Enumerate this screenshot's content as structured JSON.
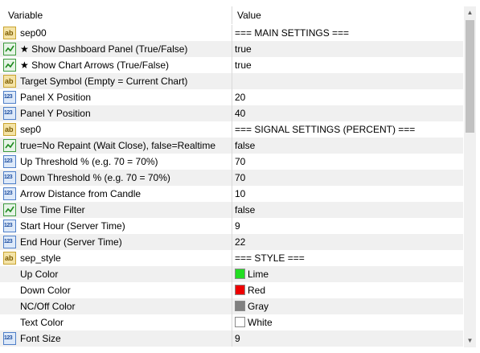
{
  "header": {
    "variable": "Variable",
    "value": "Value"
  },
  "rows": [
    {
      "type": "ab",
      "name": "sep00",
      "value": "=== MAIN SETTINGS ==="
    },
    {
      "type": "bool",
      "name": "★ Show Dashboard Panel (True/False)",
      "value": "true"
    },
    {
      "type": "bool",
      "name": "★ Show Chart Arrows (True/False)",
      "value": "true"
    },
    {
      "type": "ab",
      "name": "Target Symbol (Empty = Current Chart)",
      "value": ""
    },
    {
      "type": "num",
      "name": "Panel X Position",
      "value": "20"
    },
    {
      "type": "num",
      "name": "Panel Y Position",
      "value": "40"
    },
    {
      "type": "ab",
      "name": "sep0",
      "value": "=== SIGNAL SETTINGS (PERCENT) ==="
    },
    {
      "type": "bool",
      "name": "true=No Repaint (Wait Close), false=Realtime",
      "value": "false"
    },
    {
      "type": "num",
      "name": "Up Threshold % (e.g. 70 = 70%)",
      "value": "70"
    },
    {
      "type": "num",
      "name": "Down Threshold % (e.g. 70 = 70%)",
      "value": "70"
    },
    {
      "type": "num",
      "name": "Arrow Distance from Candle",
      "value": "10"
    },
    {
      "type": "bool",
      "name": "Use Time Filter",
      "value": "false"
    },
    {
      "type": "num",
      "name": "Start Hour (Server Time)",
      "value": "9"
    },
    {
      "type": "num",
      "name": "End Hour (Server Time)",
      "value": "22"
    },
    {
      "type": "ab",
      "name": "sep_style",
      "value": "=== STYLE ==="
    },
    {
      "type": "color",
      "name": "Up Color",
      "value": "Lime",
      "swatch": "#22dd22"
    },
    {
      "type": "color",
      "name": "Down Color",
      "value": "Red",
      "swatch": "#ee0000"
    },
    {
      "type": "color",
      "name": "NC/Off Color",
      "value": "Gray",
      "swatch": "#808080"
    },
    {
      "type": "color",
      "name": "Text Color",
      "value": "White",
      "swatch": "#ffffff"
    },
    {
      "type": "num",
      "name": "Font Size",
      "value": "9"
    }
  ],
  "icons": {
    "ab": "string-type-icon",
    "bool": "boolean-type-icon",
    "num": "number-type-icon",
    "color": "color-type-icon"
  },
  "icon_text": {
    "ab": "ab",
    "num": "123"
  },
  "scroll": {
    "up_glyph": "▲",
    "down_glyph": "▼"
  }
}
